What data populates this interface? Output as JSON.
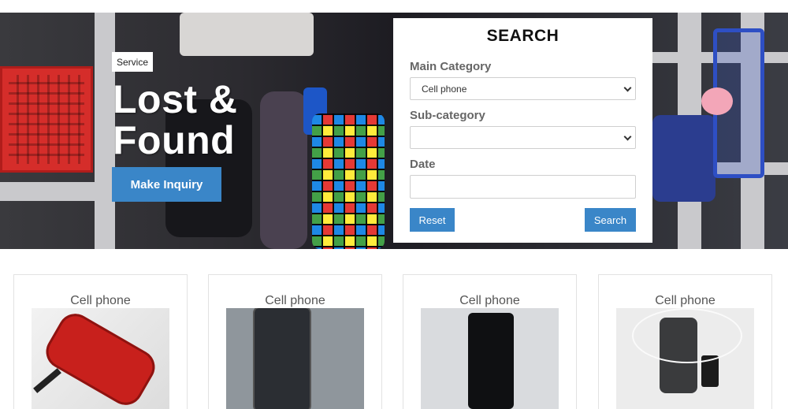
{
  "hero": {
    "tag": "Service",
    "title": "Lost & Found",
    "button": "Make Inquiry"
  },
  "search": {
    "title": "SEARCH",
    "main_category_label": "Main Category",
    "main_category_value": "Cell phone",
    "sub_category_label": "Sub-category",
    "sub_category_value": "",
    "date_label": "Date",
    "date_value": "",
    "reset": "Reset",
    "submit": "Search"
  },
  "items": [
    {
      "title": "Cell phone",
      "icon": "red-phone-image"
    },
    {
      "title": "Cell phone",
      "icon": "dark-phone-image"
    },
    {
      "title": "Cell phone",
      "icon": "black-phone-image"
    },
    {
      "title": "Cell phone",
      "icon": "phone-with-charger-image"
    }
  ],
  "colors": {
    "accent": "#3a86c8",
    "white": "#ffffff"
  }
}
